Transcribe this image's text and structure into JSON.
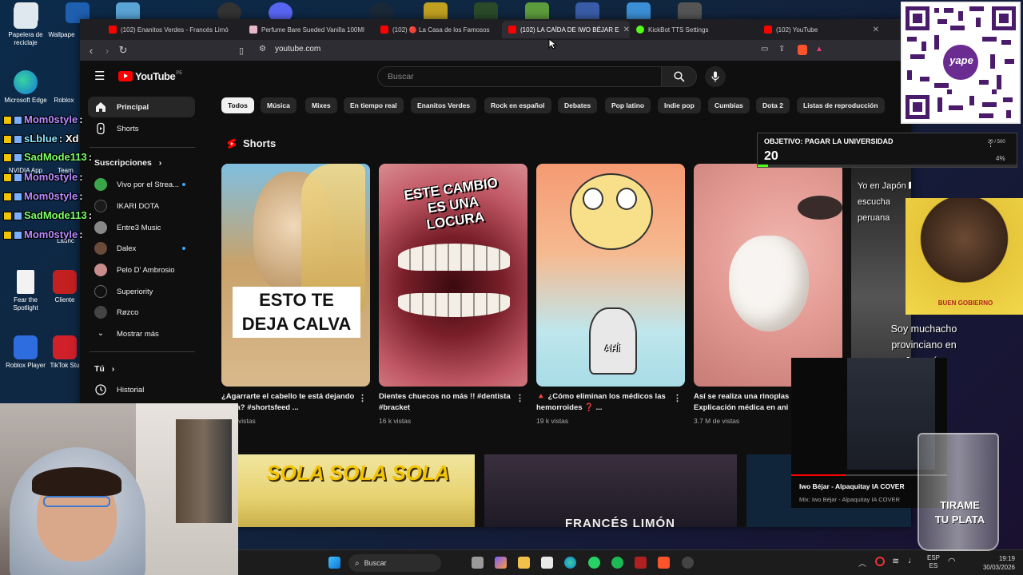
{
  "desktop": {
    "icons": [
      {
        "label": "Papelera de reciclaje"
      },
      {
        "label": "Wallpape"
      },
      {
        "label": "Microsoft Edge"
      },
      {
        "label": "Roblox"
      },
      {
        "label": "NVIDIA App"
      },
      {
        "label": "Team"
      },
      {
        "label": "Launc"
      },
      {
        "label": "Fear the Spotlight"
      },
      {
        "label": "Cliente"
      },
      {
        "label": "Roblox Player"
      },
      {
        "label": "TikTok Stu"
      }
    ]
  },
  "chat_overlay": [
    {
      "user": "Mom0style",
      "msg": ":"
    },
    {
      "user": "sLblue",
      "msg": ": Xd"
    },
    {
      "user": "SadMode113",
      "msg": ":"
    },
    {
      "user": "Mom0style",
      "msg": ":"
    },
    {
      "user": "Mom0style",
      "msg": ":"
    },
    {
      "user": "SadMode113",
      "msg": ":"
    },
    {
      "user": "Mom0style",
      "msg": ":"
    }
  ],
  "browser": {
    "tabs": [
      {
        "title": "(102) Enanitos Verdes - Francés Limó",
        "active": false
      },
      {
        "title": "Perfume Bare Sueded Vanilla 100Ml",
        "active": false
      },
      {
        "title": "(102) 🔴 La Casa de los Famosos",
        "active": false
      },
      {
        "title": "(102) LA CAÍDA DE IWO BÉJAR E",
        "active": true
      },
      {
        "title": "KickBot TTS Settings",
        "active": false
      },
      {
        "title": "(102) YouTube",
        "active": false
      }
    ],
    "url": "youtube.com",
    "colors": {
      "accent": "#ff0000"
    }
  },
  "youtube": {
    "logo": "YouTube",
    "logo_region": "PE",
    "search_placeholder": "Buscar",
    "sidebar": {
      "main": [
        {
          "label": "Principal",
          "icon": "home-icon"
        },
        {
          "label": "Shorts",
          "icon": "shorts-icon"
        }
      ],
      "subs_header": "Suscripciones",
      "subscriptions": [
        {
          "label": "Vivo por el Strea...",
          "live": true
        },
        {
          "label": "IKARI DOTA",
          "live": false
        },
        {
          "label": "Entre3 Music",
          "live": false
        },
        {
          "label": "Dalex",
          "live": true
        },
        {
          "label": "Pelo D' Ambrosio",
          "live": false
        },
        {
          "label": "Superiority",
          "live": false
        },
        {
          "label": "Røzco",
          "live": false
        }
      ],
      "show_more": "Mostrar más",
      "you_header": "Tú",
      "history": "Historial"
    },
    "chips": [
      "Todos",
      "Música",
      "Mixes",
      "En tiempo real",
      "Enanitos Verdes",
      "Rock en español",
      "Debates",
      "Pop latino",
      "Indie pop",
      "Cumbias",
      "Dota 2",
      "Listas de reproducción"
    ],
    "shorts_header": "Shorts",
    "shorts": [
      {
        "overlay": "ESTO TE DEJA CALVA",
        "title": "¿Agarrarte el cabello te está dejando calva? #shortsfeed ...",
        "views": "vistas"
      },
      {
        "overlay": "ESTE CAMBIO ES UNA LOCURA",
        "title": "Dientes chuecos no más !! #dentista #bracket",
        "views": "16 k vistas"
      },
      {
        "overlay": "AHÍ",
        "title": "🔺 ¿Cómo eliminan los médicos las hemorroides ❓ ...",
        "views": "19 k vistas"
      },
      {
        "overlay": "",
        "title": "Así se realiza una rinoplas Explicación médica en ani",
        "views": "3.7 M de vistas"
      },
      {
        "overlay": "Yo en Japón 🇯🇵 escucha peruana",
        "title": "",
        "views": ""
      }
    ],
    "second_row": [
      {
        "overlay": "SOLA SOLA SOLA"
      },
      {
        "overlay": "FRANCÉS LIMÓN"
      }
    ]
  },
  "overlays": {
    "goal": {
      "title": "OBJETIVO: PAGAR LA UNIVERSIDAD",
      "value": "20",
      "ratio": "20 / 500",
      "percent": "4%"
    },
    "dog_caption": "BUEN GOBIERNO",
    "japan_text": "Soy muchacho provinciano en Japonés",
    "player": {
      "title": "Iwo Béjar - Alpaquitay IA COVER",
      "subtitle": "Mix: Iwo Béjar - Alpaquitay IA COVER"
    },
    "tip_jar": "TIRAME TU PLATA",
    "qr_brand": "yape"
  },
  "taskbar": {
    "search": "Buscar",
    "lang": "ESP",
    "lang2": "ES",
    "time": "19:19",
    "date": "30/03/2026"
  }
}
